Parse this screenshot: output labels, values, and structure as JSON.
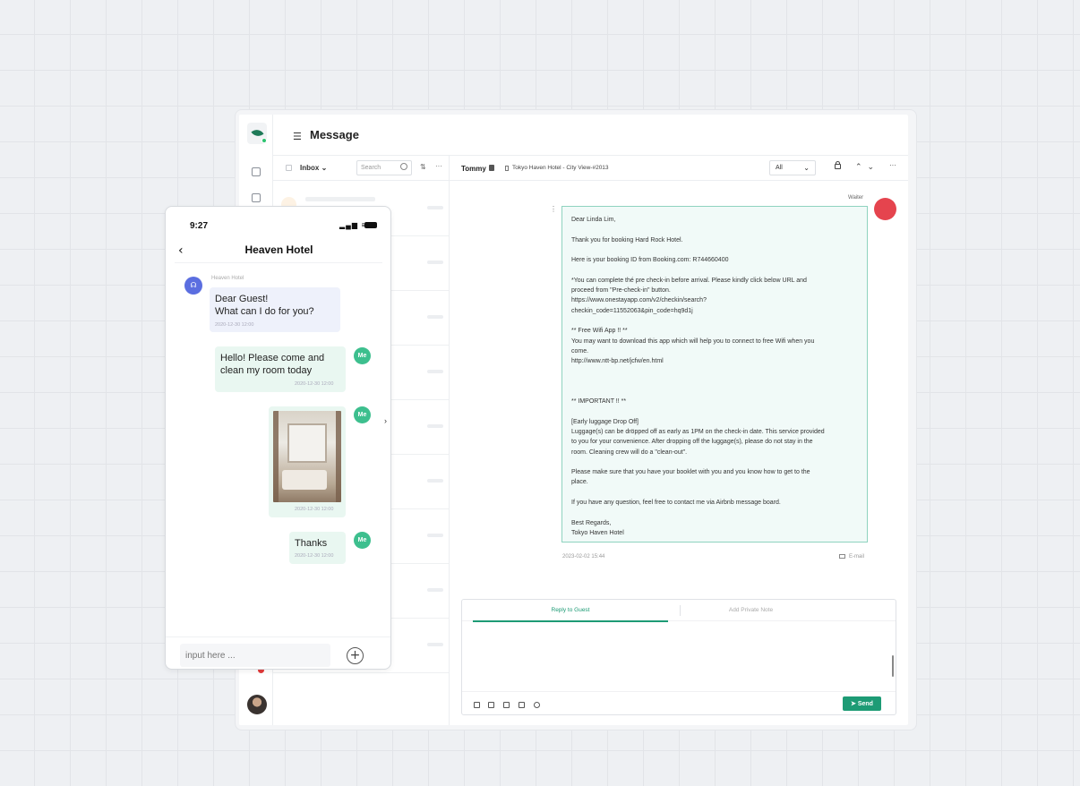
{
  "app": {
    "title": "Message"
  },
  "inbox": {
    "folder_label": "Inbox",
    "search_placeholder": "Search"
  },
  "conversation": {
    "guest_name": "Tommy",
    "property": "Tokyo Haven Hotel - City View-#2013",
    "filter_value": "All",
    "sender_label": "Waiter",
    "message_time": "2023-02-02 15:44",
    "channel": "E-mail",
    "email_paragraphs": [
      "Dear Linda Lim,",
      "Thank you for booking Hard Rock Hotel.",
      "Here is your booking ID from Booking.com: R744660400",
      "*You can complete thé pre check-in before arrival. Please kindly click below URL and\nproceed from \"Pre-check-in\" button.\nhttps://www.onestayapp.com/v2/checkin/search?\ncheckin_code=11552063&pin_code=hq9d1j",
      "** Free Wifi App !! **\nYou may want to download this app which will help you to connect to free Wifi when you\ncome.\nhttp://www.ntt-bp.net/jcfw/en.html",
      "",
      "** IMPORTANT !! **",
      "[Early luggage Drop Off]\nLuggage(s) can be dröpped off as early as 1PM on the check-in date. This service provided\nto you for your convenience. After dropping off the luggage(s), please do not stay in the\nroom. Cleaning crew will do a \"clean-out\".",
      "Please make sure that you have your booklet with you and you know how to get to the\nplace.",
      "If you have any question, feel free to contact me via Airbnb message board.",
      "Best Regards,\nTokyo Haven Hotel"
    ]
  },
  "reply": {
    "tab_reply": "Reply to Guest",
    "tab_note": "Add Private Note",
    "send_label": "Send"
  },
  "phone": {
    "time": "9:27",
    "title": "Heaven Hotel",
    "hotel_sender": "Heaven Hotel",
    "messages": [
      {
        "text": "Dear Guest!\nWhat can I do for you?",
        "time": "2020-12-30 12:00"
      },
      {
        "text": "Hello!  Please come and clean my room today",
        "time": "2020-12-30 12:00"
      },
      {
        "time": "2020-12-30 12:00"
      },
      {
        "text": "Thanks",
        "time": "2020-12-30 12:00"
      }
    ],
    "me_label": "Me",
    "input_placeholder": "input here ..."
  }
}
